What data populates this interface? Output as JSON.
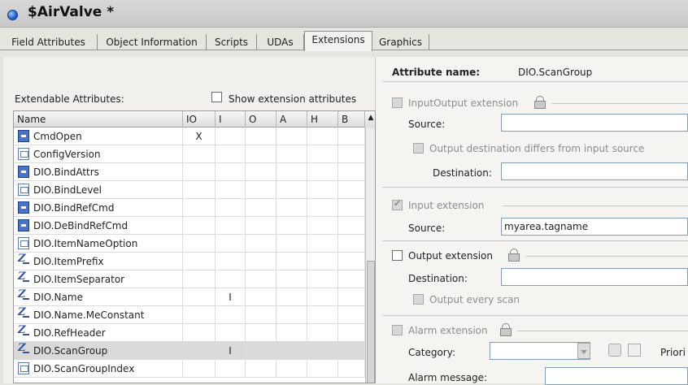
{
  "window": {
    "title": "$AirValve *"
  },
  "tabs": [
    {
      "label": "Field Attributes"
    },
    {
      "label": "Object Information"
    },
    {
      "label": "Scripts"
    },
    {
      "label": "UDAs"
    },
    {
      "label": "Extensions"
    },
    {
      "label": "Graphics"
    }
  ],
  "left": {
    "caption": "Extendable Attributes:",
    "show_ext_label": "Show extension attributes",
    "columns": [
      "Name",
      "IO",
      "I",
      "O",
      "A",
      "H",
      "B"
    ],
    "rows": [
      {
        "name": "CmdOpen",
        "icon": "command-icon",
        "io": "X",
        "i": ""
      },
      {
        "name": "ConfigVersion",
        "icon": "config-icon",
        "io": "",
        "i": ""
      },
      {
        "name": "DIO.BindAttrs",
        "icon": "command-icon",
        "io": "",
        "i": ""
      },
      {
        "name": "DIO.BindLevel",
        "icon": "config-icon",
        "io": "",
        "i": ""
      },
      {
        "name": "DIO.BindRefCmd",
        "icon": "command-icon",
        "io": "",
        "i": ""
      },
      {
        "name": "DIO.DeBindRefCmd",
        "icon": "command-icon",
        "io": "",
        "i": ""
      },
      {
        "name": "DIO.ItemNameOption",
        "icon": "config-icon",
        "io": "",
        "i": ""
      },
      {
        "name": "DIO.ItemPrefix",
        "icon": "string-icon",
        "io": "",
        "i": ""
      },
      {
        "name": "DIO.ItemSeparator",
        "icon": "string-icon",
        "io": "",
        "i": ""
      },
      {
        "name": "DIO.Name",
        "icon": "string-icon",
        "io": "",
        "i": "I"
      },
      {
        "name": "DIO.Name.MeConstant",
        "icon": "string-icon",
        "io": "",
        "i": ""
      },
      {
        "name": "DIO.RefHeader",
        "icon": "string-icon",
        "io": "",
        "i": ""
      },
      {
        "name": "DIO.ScanGroup",
        "icon": "string-icon",
        "io": "",
        "i": "I"
      },
      {
        "name": "DIO.ScanGroupIndex",
        "icon": "config-icon",
        "io": "",
        "i": ""
      }
    ]
  },
  "right": {
    "attr_name_label": "Attribute name:",
    "attr_name_value": "DIO.ScanGroup",
    "io_ext": {
      "label": "InputOutput extension",
      "source_label": "Source:",
      "source_value": "",
      "diff_label": "Output destination differs from input source",
      "dest_label": "Destination:",
      "dest_value": ""
    },
    "input_ext": {
      "label": "Input extension",
      "source_label": "Source:",
      "source_value": "myarea.tagname"
    },
    "output_ext": {
      "label": "Output extension",
      "dest_label": "Destination:",
      "dest_value": "",
      "every_scan_label": "Output every scan"
    },
    "alarm_ext": {
      "label": "Alarm extension",
      "category_label": "Category:",
      "category_value": "",
      "priority_label": "Priori",
      "message_label": "Alarm message:"
    }
  }
}
